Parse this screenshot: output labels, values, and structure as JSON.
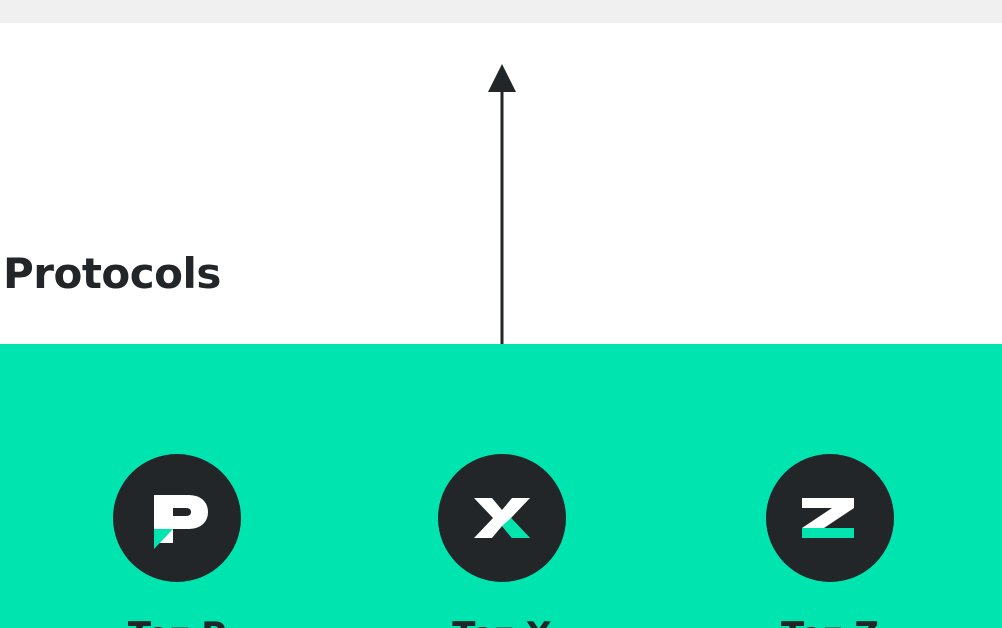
{
  "section": {
    "title": "Protocols"
  },
  "colors": {
    "accent": "#00e5b0",
    "dark": "#222628",
    "top_strip": "#f0f0f0"
  },
  "protocols": [
    {
      "name": "Tez P",
      "icon": "p-logo-icon"
    },
    {
      "name": "Tez X",
      "icon": "x-logo-icon"
    },
    {
      "name": "Tez Z",
      "icon": "z-logo-icon"
    }
  ]
}
